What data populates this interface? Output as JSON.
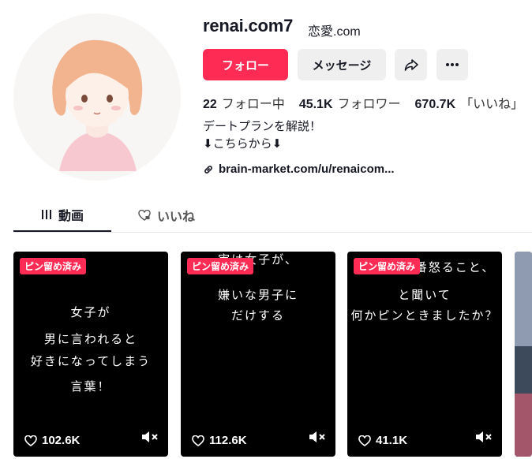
{
  "profile": {
    "username": "renai.com7",
    "nickname": "恋愛.com",
    "follow_label": "フォロー",
    "message_label": "メッセージ",
    "stats": [
      {
        "value": "22",
        "label": "フォロー中"
      },
      {
        "value": "45.1K",
        "label": "フォロワー"
      },
      {
        "value": "670.7K",
        "label": "「いいね」"
      }
    ],
    "bio_line1": "デートプランを解説！",
    "bio_line2": "⬇こちらから⬇",
    "link": "brain-market.com/u/renaicom..."
  },
  "tabs": {
    "videos": "動画",
    "likes": "いいね"
  },
  "videos": [
    {
      "badge": "ピン留め済み",
      "lines": [
        "女子が",
        "男に言われると",
        "好きになってしまう",
        "言葉！"
      ],
      "likes": "102.6K"
    },
    {
      "badge": "ピン留め済み",
      "lines": [
        "実は女子が、",
        "嫌いな男子に",
        "だけする"
      ],
      "likes": "112.6K"
    },
    {
      "badge": "ピン留め済み",
      "lines": [
        "一番怒ること、",
        "と聞いて",
        "何かピンときましたか？"
      ],
      "likes": "41.1K"
    }
  ],
  "colors": {
    "accent": "#fe2c55",
    "card_bg": "#000000"
  }
}
